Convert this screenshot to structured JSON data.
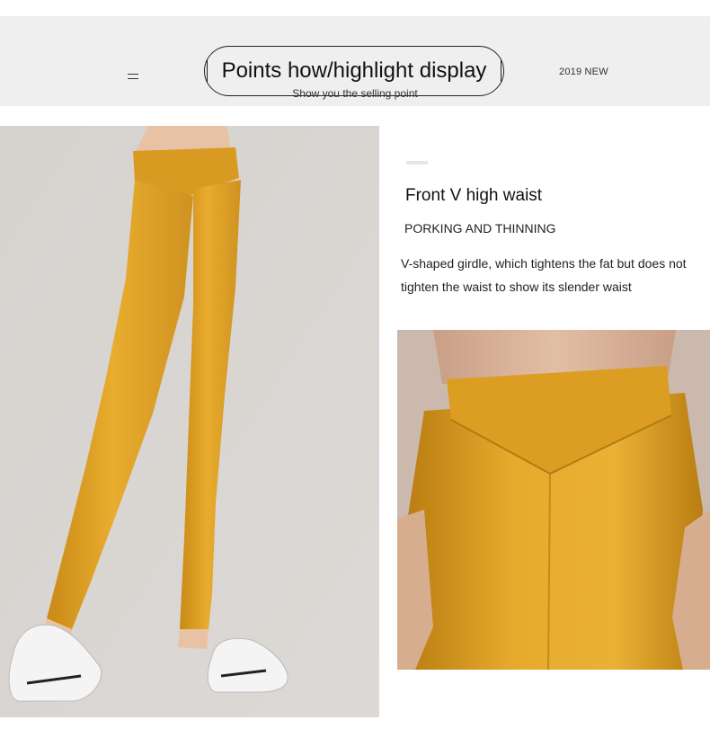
{
  "header": {
    "title": "Points how/highlight display",
    "badge": "2019 NEW",
    "subtitle": "Show you the selling point"
  },
  "feature": {
    "title": "Front V high waist",
    "subtitle": "PORKING AND THINNING",
    "description": "V-shaped girdle, which tightens the fat but does not tighten the waist to show its slender waist"
  },
  "colors": {
    "legging": "#e3a52a",
    "banner_bg": "#efefef"
  }
}
